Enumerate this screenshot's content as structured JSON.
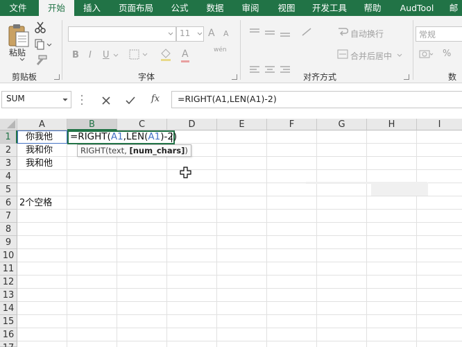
{
  "ribbon_tabs": [
    "文件",
    "开始",
    "插入",
    "页面布局",
    "公式",
    "数据",
    "审阅",
    "视图",
    "开发工具",
    "帮助",
    "AudTool",
    "邮"
  ],
  "active_tab": "开始",
  "clipboard": {
    "paste_label": "粘贴",
    "group_label": "剪贴板"
  },
  "font": {
    "name_value": "",
    "size_value": "11",
    "bold": "B",
    "italic": "I",
    "underline": "U",
    "grow": "A",
    "shrink": "A",
    "font_color": "A",
    "phonetic": "wén",
    "group_label": "字体"
  },
  "alignment": {
    "wrap_text": "自动换行",
    "merge_center": "合并后居中",
    "group_label": "对齐方式"
  },
  "number": {
    "format_value": "常规",
    "percent": "%",
    "group_label": "数字"
  },
  "formula_bar": {
    "name_box": "SUM",
    "fx": "fx",
    "formula": "=RIGHT(A1,LEN(A1)-2)"
  },
  "columns": [
    "A",
    "B",
    "C",
    "D",
    "E",
    "F",
    "G",
    "H",
    "I"
  ],
  "rows": [
    "1",
    "2",
    "3",
    "4",
    "5",
    "6",
    "7",
    "8",
    "9",
    "10",
    "11",
    "12",
    "13",
    "14",
    "15",
    "16",
    "17"
  ],
  "cells": {
    "a1": "你我他",
    "a2": "我和你",
    "a3": "我和他",
    "a6": "2个空格"
  },
  "edit": {
    "prefix": "=RIGHT(",
    "ref1": "A1",
    "mid": ",LEN(",
    "ref2": "A1",
    "suffix": ")-2)"
  },
  "tooltip": {
    "func": "RIGHT(text, ",
    "arg": "[num_chars]",
    "close": ")"
  },
  "colors": {
    "excel_green": "#217346",
    "ref_blue": "#4472c4"
  }
}
